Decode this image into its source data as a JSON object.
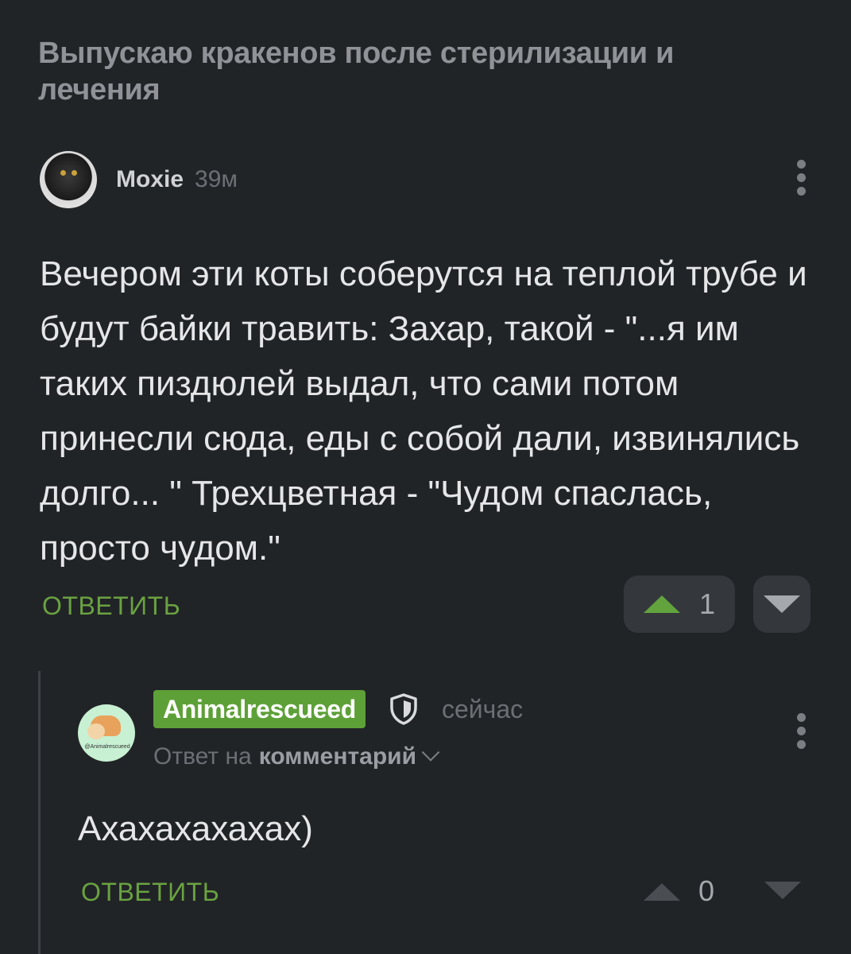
{
  "post": {
    "title": "Выпускаю кракенов после стерилизации и лечения"
  },
  "comment": {
    "author": "Moxie",
    "time": "39м",
    "body": "Вечером эти коты соберутся на теплой трубе и будут байки травить: Захар, такой - \"...я им таких пиздюлей выдал, что сами потом принесли сюда, еды с собой дали, извинялись долго... \" Трехцветная - \"Чудом спаслась, просто чудом.\"",
    "reply_label": "ОТВЕТИТЬ",
    "votes": "1"
  },
  "reply": {
    "author": "Animalrescueed",
    "time": "сейчас",
    "reply_to_prefix": "Ответ на",
    "reply_to_target": "комментарий",
    "body": "Ахахахахахах)",
    "reply_label": "ОТВЕТИТЬ",
    "votes": "0",
    "avatar_caption": "@Animalrescueed"
  },
  "colors": {
    "background": "#212427",
    "accent_green": "#6aa241",
    "badge_green": "#5ea038"
  },
  "icons": {
    "more": "vertical-ellipsis",
    "upvote": "triangle-up",
    "downvote": "triangle-down",
    "shield": "shield-icon",
    "chevron": "chevron-down"
  }
}
